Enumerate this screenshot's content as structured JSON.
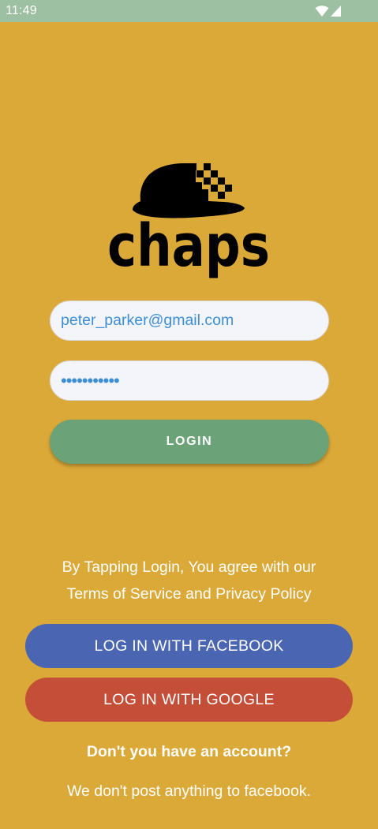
{
  "status_bar": {
    "time": "11:49",
    "icons": [
      "wifi-icon",
      "signal-icon"
    ]
  },
  "logo": {
    "brand_text": "chaps",
    "icon": "bowler-hat-icon"
  },
  "login_form": {
    "email_value": "peter_parker@gmail.com",
    "password_value": "•••••••••••",
    "login_label": "LOGIN"
  },
  "terms": {
    "line1": "By Tapping Login, You agree with our",
    "line2": "Terms of Service and Privacy Policy"
  },
  "social": {
    "facebook_label": "LOG IN WITH FACEBOOK",
    "google_label": "LOG IN WITH GOOGLE"
  },
  "footer": {
    "account_question": "Don't you have an account?",
    "facebook_note": "We don't post anything to facebook."
  },
  "colors": {
    "background": "#DBA937",
    "status_bar": "#9DC0A2",
    "login_button": "#6CA277",
    "facebook_button": "#4A65B2",
    "google_button": "#C44E37",
    "input_text": "#3E8ED6"
  }
}
